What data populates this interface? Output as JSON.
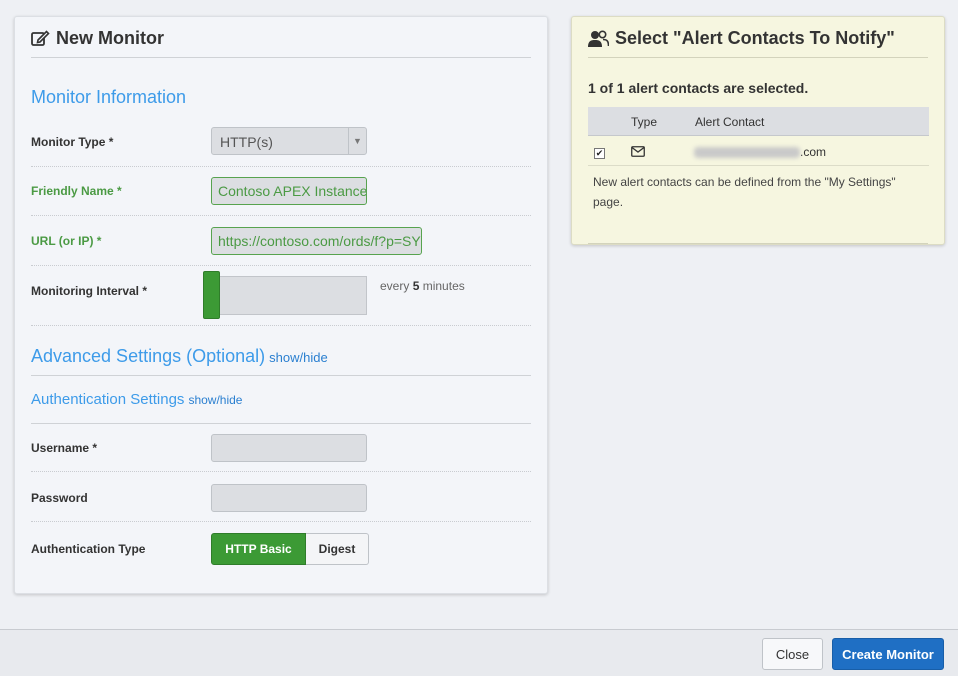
{
  "left_panel": {
    "title": "New Monitor",
    "title_icon": "edit-icon",
    "monitor_info_heading": "Monitor Information",
    "fields": {
      "monitor_type": {
        "label": "Monitor Type *",
        "value": "HTTP(s)"
      },
      "friendly_name": {
        "label": "Friendly Name *",
        "value": "Contoso APEX Instance"
      },
      "url": {
        "label": "URL (or IP) *",
        "value": "https://contoso.com/ords/f?p=SYS"
      },
      "interval": {
        "label": "Monitoring Interval *",
        "prefix": "every",
        "value": "5",
        "suffix": "minutes",
        "slider_fraction": 0.0
      }
    },
    "advanced": {
      "heading": "Advanced Settings (Optional)",
      "toggle": "show/hide"
    },
    "auth": {
      "heading": "Authentication Settings",
      "toggle": "show/hide",
      "username_label": "Username *",
      "username_value": "",
      "password_label": "Password",
      "password_value": "",
      "type_label": "Authentication Type",
      "options": [
        "HTTP Basic",
        "Digest"
      ],
      "selected": "HTTP Basic"
    }
  },
  "right_panel": {
    "title": "Select \"Alert Contacts To Notify\"",
    "title_icon": "users-icon",
    "selected_text": "1 of 1 alert contacts are selected.",
    "columns": [
      "Type",
      "Alert Contact"
    ],
    "rows": [
      {
        "checked": true,
        "type_icon": "envelope-icon",
        "contact_suffix": ".com"
      }
    ],
    "note": "New alert contacts can be defined from the \"My Settings\" page."
  },
  "footer": {
    "close_label": "Close",
    "create_label": "Create Monitor"
  },
  "colors": {
    "accent_blue": "#3d9be9",
    "green": "#3c9a35",
    "primary_button": "#1f6fc4",
    "right_panel_bg": "#f6f6e0"
  }
}
